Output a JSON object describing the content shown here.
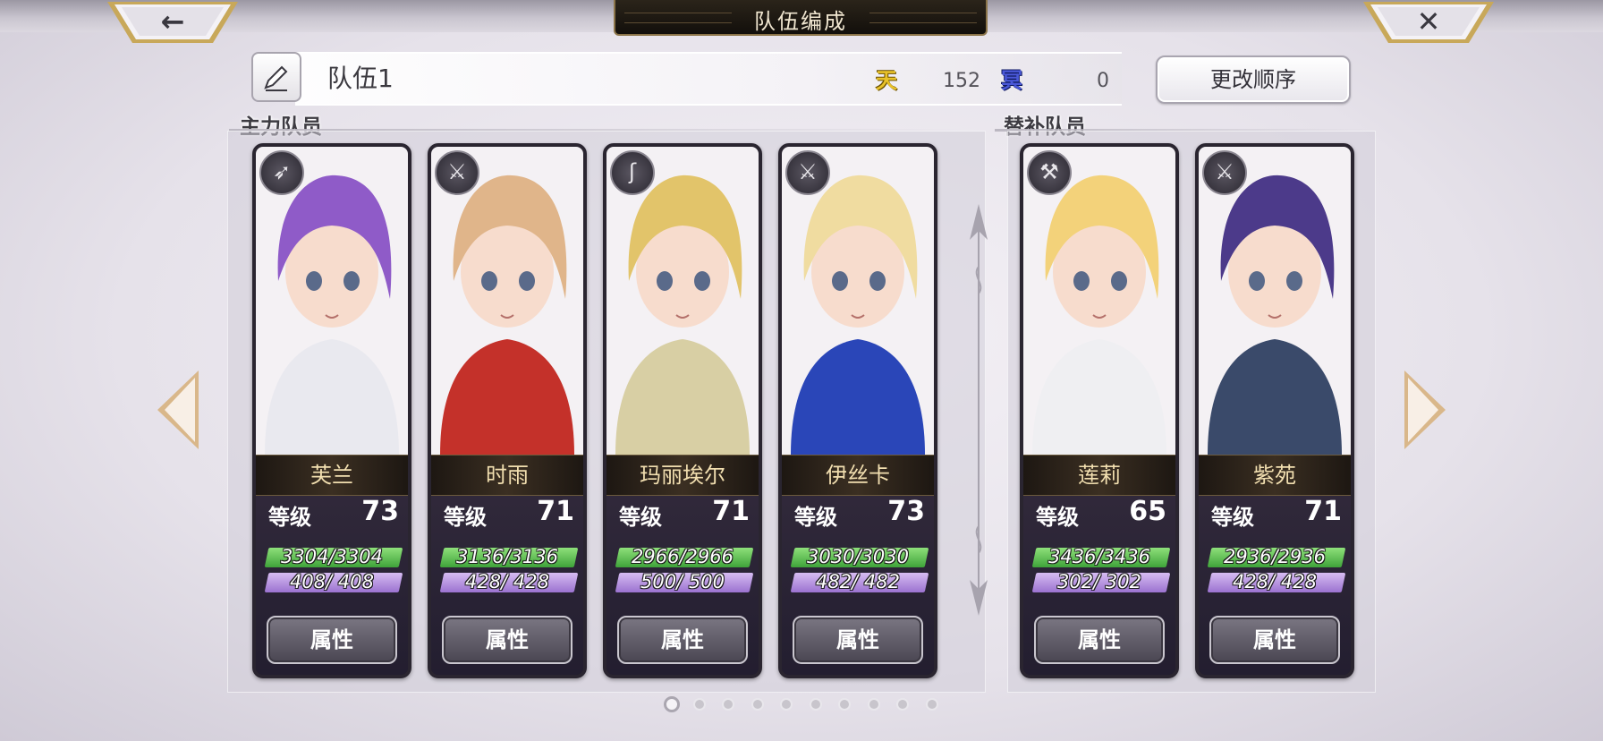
{
  "header": {
    "title": "队伍编成",
    "back_glyph": "←",
    "close_glyph": "✕"
  },
  "team": {
    "name": "队伍1",
    "ten_icon": "天",
    "ten_value": "152",
    "ming_icon": "冥",
    "ming_value": "0",
    "reorder_label": "更改顺序",
    "edit_icon": "pen-icon"
  },
  "sections": {
    "main_label": "主力队员",
    "sub_label": "替补队员"
  },
  "level_label": "等级",
  "attr_label": "属性",
  "members": [
    {
      "name": "芙兰",
      "level": "73",
      "hp": "3304/3304",
      "mp": "408/ 408",
      "weapon_icon": "spear-icon",
      "weapon_glyph": "➶"
    },
    {
      "name": "时雨",
      "level": "71",
      "hp": "3136/3136",
      "mp": "428/ 428",
      "weapon_icon": "sword-icon",
      "weapon_glyph": "⚔"
    },
    {
      "name": "玛丽埃尔",
      "level": "71",
      "hp": "2966/2966",
      "mp": "500/ 500",
      "weapon_icon": "staff-icon",
      "weapon_glyph": "ʃ"
    },
    {
      "name": "伊丝卡",
      "level": "73",
      "hp": "3030/3030",
      "mp": "482/ 482",
      "weapon_icon": "sword-icon",
      "weapon_glyph": "⚔"
    },
    {
      "name": "莲莉",
      "level": "65",
      "hp": "3436/3436",
      "mp": "302/ 302",
      "weapon_icon": "axe-icon",
      "weapon_glyph": "⚒"
    },
    {
      "name": "紫苑",
      "level": "71",
      "hp": "2936/2936",
      "mp": "428/ 428",
      "weapon_icon": "sword-icon",
      "weapon_glyph": "⚔"
    }
  ],
  "pagination": {
    "count": 10,
    "active": 0
  },
  "colors": {
    "hp": "#5ec24f",
    "mp": "#b796e6",
    "ten": "#e8c22a",
    "ming": "#4a58d8"
  }
}
